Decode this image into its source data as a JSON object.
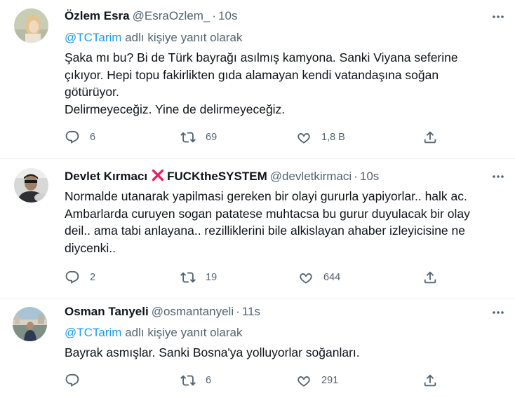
{
  "tweets": [
    {
      "name": "Özlem Esra",
      "handle": "@EsraOzlem_",
      "separator": "·",
      "time": "10s",
      "reply_mention": "@TCTarim",
      "reply_suffix": " adlı kişiye yanıt olarak",
      "text": "Şaka mı bu? Bi de Türk bayrağı asılmış kamyona. Sanki Viyana seferine\nçıkıyor. Hepi topu fakirlikten gıda alamayan kendi vatandaşına soğan\ngötürüyor.\nDelirmeyeceğiz. Yine de delirmeyeceğiz.",
      "replies": "6",
      "retweets": "69",
      "likes": "1,8 B"
    },
    {
      "name": "Devlet Kırmacı",
      "name_suffix": "FUCKtheSYSTEM",
      "handle": "@devletkirmaci",
      "separator": "·",
      "time": "10s",
      "text": "Normalde utanarak yapilmasi gereken bir olayi gururla yapiyorlar.. halk ac.\nAmbarlarda curuyen sogan patatese muhtacsa bu gurur duyulacak bir olay\ndeil.. ama tabi anlayana.. rezilliklerini bile alkislayan ahaber izleyicisine ne\ndiycenki..",
      "replies": "2",
      "retweets": "19",
      "likes": "644"
    },
    {
      "name": "Osman Tanyeli",
      "handle": "@osmantanyeli",
      "separator": "·",
      "time": "11s",
      "reply_mention": "@TCTarim",
      "reply_suffix": " adlı kişiye yanıt olarak",
      "text": "Bayrak asmışlar. Sanki Bosna'ya yolluyorlar soğanları.",
      "replies": "",
      "retweets": "6",
      "likes": "291"
    }
  ],
  "icons": {
    "reply": "reply-icon",
    "retweet": "retweet-icon",
    "like": "heart-icon",
    "share": "share-icon",
    "more": "more-icon",
    "cross": "cross-mark-icon"
  },
  "colors": {
    "primary_text": "#0f1419",
    "secondary_text": "#536471",
    "link": "#1d9bf0",
    "cross": "#e0245e"
  }
}
